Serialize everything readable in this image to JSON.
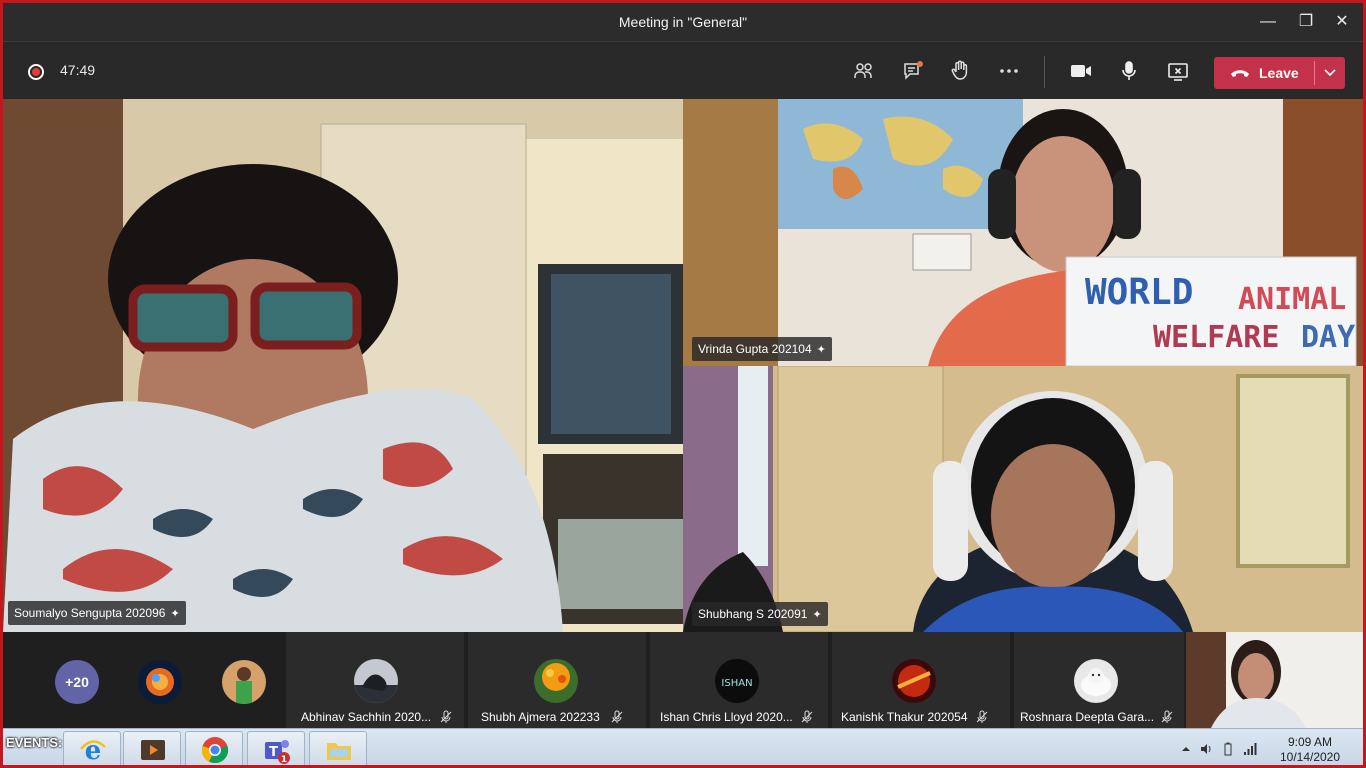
{
  "window": {
    "title": "Meeting in \"General\"",
    "controls": {
      "minimize": "—",
      "maximize": "❐",
      "close": "✕"
    }
  },
  "toolbar": {
    "timer": "47:49",
    "icons": [
      "participants-icon",
      "chat-icon",
      "raise-hand-icon",
      "more-options-icon",
      "camera-icon",
      "microphone-icon",
      "share-screen-icon"
    ],
    "leave_label": "Leave",
    "leave_color": "#c4314b"
  },
  "videos": [
    {
      "name": "Soumalyo Sengupta 202096"
    },
    {
      "name": "Vrinda Gupta 202104",
      "sign_line1_a": "WORLD",
      "sign_line1_b": "ANIMAL",
      "sign_line2_a": "WELFARE",
      "sign_line2_b": "DAY"
    },
    {
      "name": "Shubhang S 202091"
    }
  ],
  "participants": {
    "more_count": "+20",
    "cards": [
      {
        "name": "Abhinav Sachhin 2020..."
      },
      {
        "name": "Shubh Ajmera 202233"
      },
      {
        "name": "Ishan Chris Lloyd 2020...",
        "avatar_text": "ISHAN"
      },
      {
        "name": "Kanishk Thakur 202054"
      },
      {
        "name": "Roshnara Deepta Gara..."
      }
    ]
  },
  "taskbar": {
    "events_label": "EVENTS:",
    "teams_badge": "1",
    "clock_time": "9:09 AM",
    "clock_date": "10/14/2020"
  }
}
